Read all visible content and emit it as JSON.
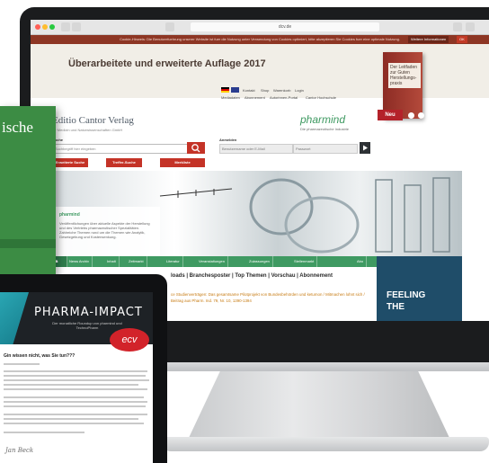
{
  "browser": {
    "url": "dcv.de",
    "cookie_notice": "Cookie-Hinweis: Die Benutzerfuehrung unserer Website ist fuer die Nutzung unter Verwendung von Cookies optimiert, bitte akzeptieren Sie Cookies fuer eine optimale Nutzung.",
    "cookie_more": "Weitere Informationen",
    "cookie_ok": "OK"
  },
  "banner": {
    "title": "Überarbeitete und erweiterte Auflage 2017",
    "book_label": "Der Leitfaden zur Guten Herstellungs-praxis",
    "new_badge": "Neu"
  },
  "header": {
    "top_links": [
      "Kontakt",
      "Shop",
      "Warenkorb",
      "Login"
    ],
    "sub_links": [
      "Mediadaten",
      "Abonnement",
      "Autorinnen-Portal",
      "Cantor Hochschule"
    ],
    "publisher": "Editio Cantor Verlag",
    "publisher_sub": "für Medizin und Naturwissenschaften GmbH",
    "pharmind": "pharmind",
    "pharmind_sub": "Die pharmazeutische Industrie"
  },
  "search": {
    "label": "Suche",
    "placeholder": "Suchbegriff hier eingeben",
    "buttons": [
      "Erweiterte Suche",
      "Treffer-Suche",
      "Merkliste"
    ],
    "login_label": "Anmelden",
    "user_placeholder": "Benutzername oder E-Mail",
    "pass_placeholder": "Passwort"
  },
  "hero": {
    "card_title": "pharmind",
    "card_text": "Veröffentlichungen über aktuelle Aspekte der Herstellung und des Vertriebs pharmazeutischer Spezialitäten. Zahlreiche Themen rund um die Themen wie Analytik, Gesetzgebung und Kostensenkung."
  },
  "nav": {
    "items": [
      "News Archiv",
      "Inhalt",
      "Zeitmarkt",
      "Literatur",
      "Veranstaltungen",
      "Zulassungen",
      "Stellenmarkt",
      "Abo"
    ]
  },
  "content": {
    "links": "loads | Branchesposter | Top Themen | Vorschau | Abonnement",
    "news": "ce Studienverträgen: Das gesamtsame Pilotprojekt von Bundesbehörden und ketumon / Mitmachen lohnt sich / Beitrag aus Pharm. Ind. 79, Nr. 10, 1390-1394"
  },
  "promo": {
    "line1": "FEELING",
    "line2": "THE"
  },
  "magazine": {
    "title": "ische"
  },
  "tablet": {
    "title": "PHARMA-IMPACT",
    "subtitle": "Der monatliche Roundup von pharmind und TechnoPharm",
    "logo": "ecv",
    "heading": "Gin wissen nicht, was Sie tun???",
    "signature": "Jan Beck"
  }
}
